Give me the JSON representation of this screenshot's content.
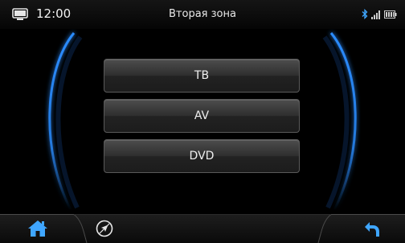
{
  "statusbar": {
    "time": "12:00",
    "title": "Вторая зона",
    "icons": [
      "device-icon",
      "bluetooth-icon",
      "signal-icon",
      "battery-icon"
    ]
  },
  "menu": {
    "items": [
      {
        "label": "ТВ"
      },
      {
        "label": "AV"
      },
      {
        "label": "DVD"
      }
    ]
  },
  "bottombar": {
    "icons": [
      "home-icon",
      "navigation-icon",
      "back-icon"
    ]
  },
  "colors": {
    "accent": "#2a8cff",
    "home_icon": "#3fa6ff",
    "background": "#000000"
  }
}
